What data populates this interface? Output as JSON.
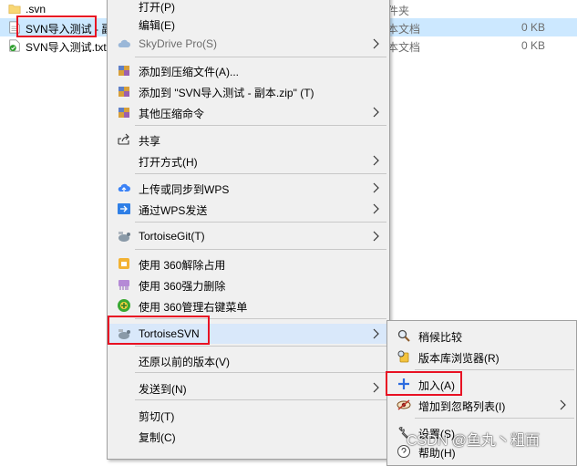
{
  "files": [
    {
      "name": ".svn",
      "type": "件夹",
      "size": "",
      "selected": false
    },
    {
      "name": "SVN导入测试 - 副",
      "type": "本文档",
      "size": "0 KB",
      "selected": true
    },
    {
      "name": "SVN导入测试.txt",
      "type": "本文档",
      "size": "0 KB",
      "selected": false
    }
  ],
  "menu": {
    "open": "打开(P)",
    "edit": "编辑(E)",
    "skydrive": "SkyDrive Pro(S)",
    "add_archive": "添加到压缩文件(A)...",
    "add_zip": "添加到 \"SVN导入测试 - 副本.zip\" (T)",
    "other_compress": "其他压缩命令",
    "share": "共享",
    "open_with": "打开方式(H)",
    "upload_wps": "上传或同步到WPS",
    "send_wps": "通过WPS发送",
    "tortoisegit": "TortoiseGit(T)",
    "unlock_360": "使用 360解除占用",
    "force_delete_360": "使用 360强力删除",
    "manage_360": "使用 360管理右键菜单",
    "tortoisesvn": "TortoiseSVN",
    "restore": "还原以前的版本(V)",
    "send_to": "发送到(N)",
    "cut": "剪切(T)",
    "copy": "复制(C)"
  },
  "submenu": {
    "diff_later": "稍候比较",
    "repo_browser": "版本库浏览器(R)",
    "add": "加入(A)",
    "add_ignore": "增加到忽略列表(I)",
    "settings": "设置(S)",
    "help": "帮助(H)"
  },
  "watermark": "CSDN @鱼丸丶粗面",
  "colors": {
    "highlight_box": "#e81123",
    "selection": "#cce8ff",
    "menu_bg": "#f0f0f0"
  }
}
